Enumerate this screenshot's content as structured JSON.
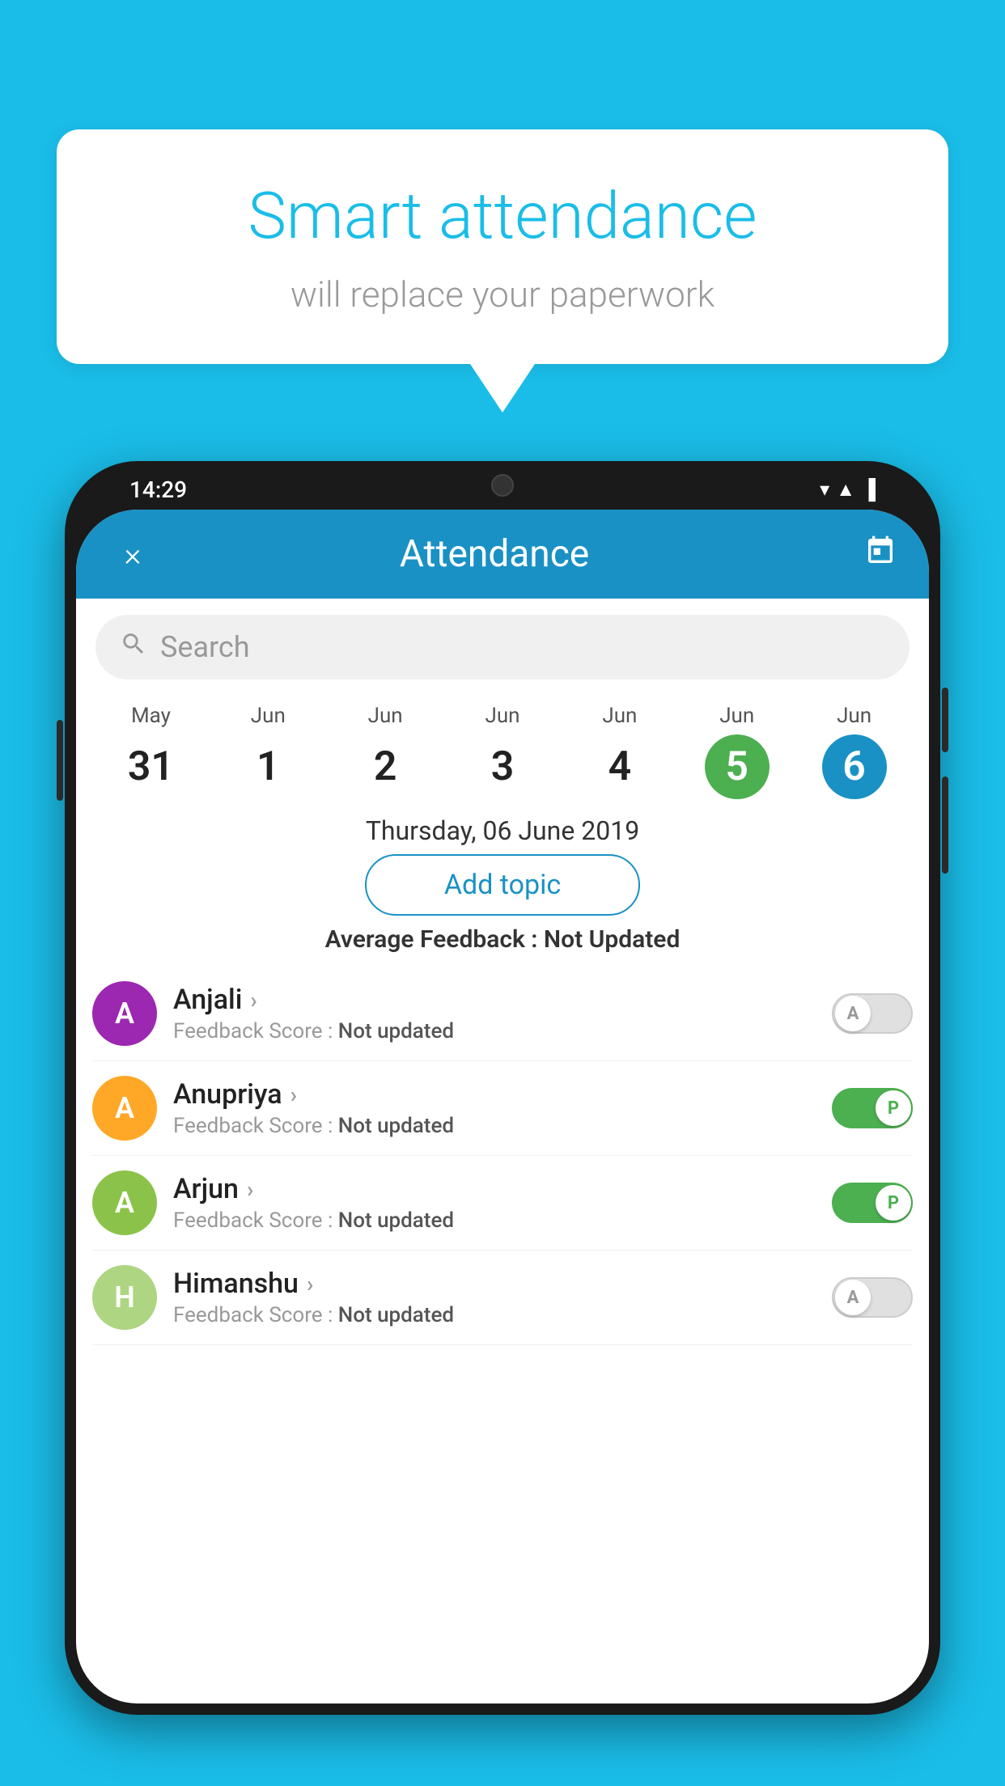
{
  "background_color": "#1ABDE8",
  "speech_bubble": {
    "title": "Smart attendance",
    "subtitle": "will replace your paperwork"
  },
  "status_bar": {
    "time": "14:29",
    "wifi": "▼",
    "signal": "▲",
    "battery": "▌"
  },
  "header": {
    "title": "Attendance",
    "close_label": "×",
    "calendar_icon": "calendar"
  },
  "search": {
    "placeholder": "Search"
  },
  "calendar": {
    "days": [
      {
        "month": "May",
        "date": "31",
        "style": "normal"
      },
      {
        "month": "Jun",
        "date": "1",
        "style": "normal"
      },
      {
        "month": "Jun",
        "date": "2",
        "style": "normal"
      },
      {
        "month": "Jun",
        "date": "3",
        "style": "normal"
      },
      {
        "month": "Jun",
        "date": "4",
        "style": "normal"
      },
      {
        "month": "Jun",
        "date": "5",
        "style": "green"
      },
      {
        "month": "Jun",
        "date": "6",
        "style": "blue"
      }
    ],
    "selected_date": "Thursday, 06 June 2019"
  },
  "add_topic_label": "Add topic",
  "avg_feedback_label": "Average Feedback : ",
  "avg_feedback_value": "Not Updated",
  "students": [
    {
      "name": "Anjali",
      "avatar_letter": "A",
      "avatar_color": "#9C27B0",
      "feedback_label": "Feedback Score : ",
      "feedback_value": "Not updated",
      "attendance": "absent",
      "toggle_label": "A"
    },
    {
      "name": "Anupriya",
      "avatar_letter": "A",
      "avatar_color": "#FFA726",
      "feedback_label": "Feedback Score : ",
      "feedback_value": "Not updated",
      "attendance": "present",
      "toggle_label": "P"
    },
    {
      "name": "Arjun",
      "avatar_letter": "A",
      "avatar_color": "#8BC34A",
      "feedback_label": "Feedback Score : ",
      "feedback_value": "Not updated",
      "attendance": "present",
      "toggle_label": "P"
    },
    {
      "name": "Himanshu",
      "avatar_letter": "H",
      "avatar_color": "#AED581",
      "feedback_label": "Feedback Score : ",
      "feedback_value": "Not updated",
      "attendance": "absent",
      "toggle_label": "A"
    }
  ]
}
